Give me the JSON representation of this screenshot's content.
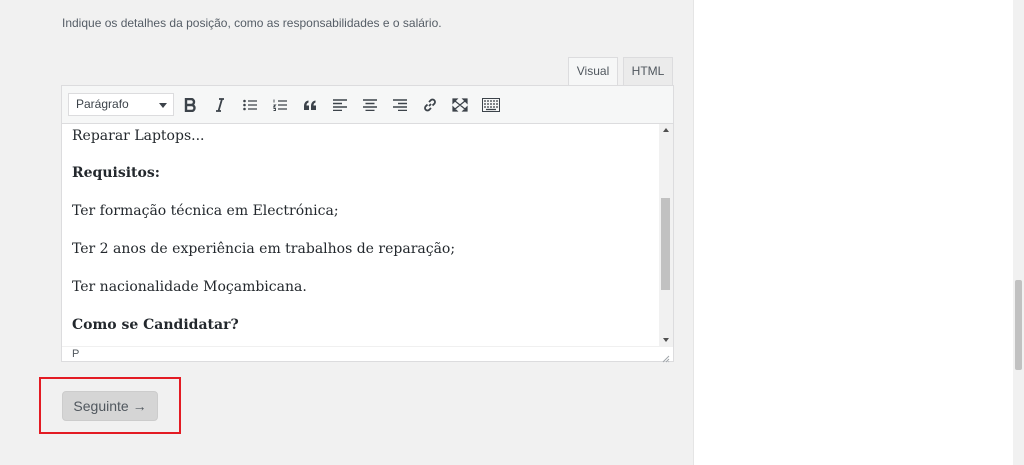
{
  "description": "Indique os detalhes da posição, como as responsabilidades e o salário.",
  "editor": {
    "tabs": [
      {
        "label": "Visual",
        "active": true
      },
      {
        "label": "HTML",
        "active": false
      }
    ],
    "toolbar": {
      "format_select": "Parágrafo",
      "buttons": [
        "bold-icon",
        "italic-icon",
        "bullet-list-icon",
        "numbered-list-icon",
        "blockquote-icon",
        "align-left-icon",
        "align-center-icon",
        "align-right-icon",
        "link-icon",
        "fullscreen-icon",
        "toolbar-toggle-icon"
      ]
    },
    "paragraphs": [
      {
        "text": "Reparar Laptops...",
        "bold": false
      },
      {
        "text": "Requisitos:",
        "bold": true
      },
      {
        "text": "Ter formação técnica em Electrónica;",
        "bold": false
      },
      {
        "text": "Ter 2 anos de experiência em trabalhos de reparação;",
        "bold": false
      },
      {
        "text": "Ter nacionalidade Moçambicana.",
        "bold": false
      },
      {
        "text": "Como se Candidatar?",
        "bold": true
      }
    ],
    "status_path": "P"
  },
  "next_button": {
    "label": "Seguinte →"
  },
  "colors": {
    "highlight": "#e31b23",
    "background": "#f1f1f1",
    "button_bg": "#d5d5d5"
  }
}
